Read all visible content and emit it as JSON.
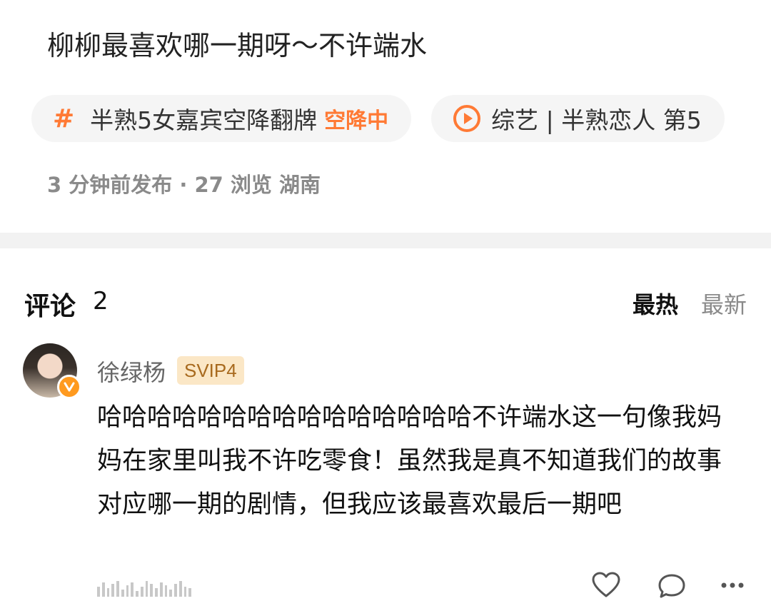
{
  "post": {
    "title": "柳柳最喜欢哪一期呀～不许端水",
    "chips": [
      {
        "icon": "hash-icon",
        "text": "半熟5女嘉宾空降翻牌",
        "badge": "空降中"
      },
      {
        "icon": "play-icon",
        "text": "综艺 | 半熟恋人 第5"
      }
    ],
    "meta": "3 分钟前发布 · 27 浏览 湖南"
  },
  "comments": {
    "label": "评论",
    "count": "2",
    "sort_hot": "最热",
    "sort_new": "最新",
    "items": [
      {
        "username": "徐绿杨",
        "vip": "SVIP4",
        "text": "哈哈哈哈哈哈哈哈哈哈哈哈哈哈哈不许端水这一句像我妈妈在家里叫我不许吃零食！虽然我是真不知道我们的故事对应哪一期的剧情，但我应该最喜欢最后一期吧"
      }
    ]
  },
  "colors": {
    "accent": "#ff7a35",
    "vip_bg": "#fbe7c6",
    "vip_text": "#a86a1e",
    "verified": "#ff9a1f"
  },
  "icons": [
    "hash-icon",
    "play-icon",
    "heart-icon",
    "comment-icon",
    "more-icon",
    "verified-icon"
  ]
}
